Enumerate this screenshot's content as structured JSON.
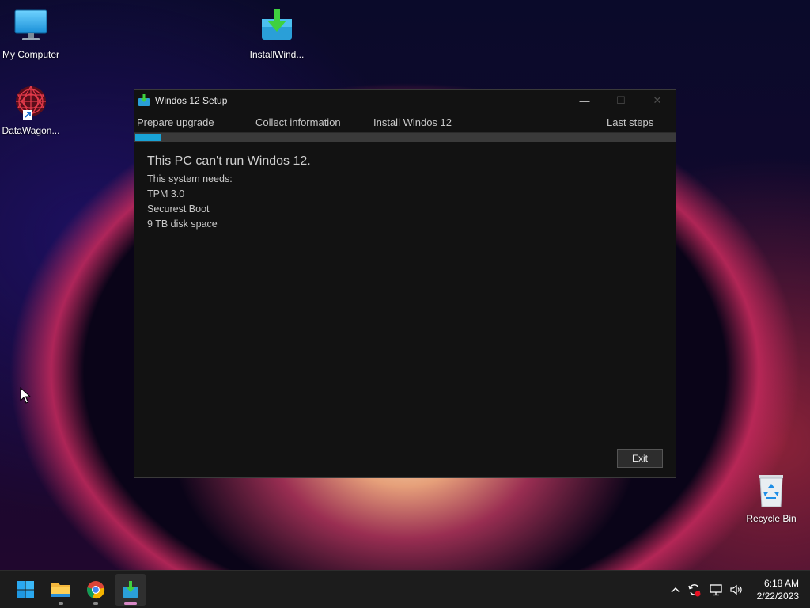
{
  "desktop": {
    "icons": [
      {
        "label": "My Computer",
        "icon": "monitor-icon"
      },
      {
        "label": "InstallWind...",
        "icon": "download-installer-icon"
      },
      {
        "label": "DataWagon...",
        "icon": "datawagon-shortcut-icon"
      },
      {
        "label": "Recycle Bin",
        "icon": "recycle-bin-icon"
      }
    ]
  },
  "window": {
    "title": "Windos 12 Setup",
    "controls": {
      "minimize": "—",
      "maximize": "☐",
      "close": "✕"
    },
    "steps": [
      "Prepare upgrade",
      "Collect information",
      "Install Windos 12",
      "Last steps"
    ],
    "progress": 0.05,
    "headline": "This PC can't run Windos 12.",
    "requirements_intro": "This system needs:",
    "requirements": [
      "TPM 3.0",
      "Securest Boot",
      "9 TB disk space"
    ],
    "exit_label": "Exit"
  },
  "taskbar": {
    "apps": [
      "windows-start-icon",
      "file-explorer-icon",
      "chrome-icon",
      "setup-installer-icon"
    ],
    "tray_icons": [
      "chevron-up-icon",
      "sync-alert-icon",
      "network-icon",
      "volume-icon"
    ],
    "time": "6:18 AM",
    "date": "2/22/2023"
  },
  "colors": {
    "accent": "#19a3d6",
    "window_bg": "#121212",
    "taskbar_bg": "#1c1c1c"
  }
}
